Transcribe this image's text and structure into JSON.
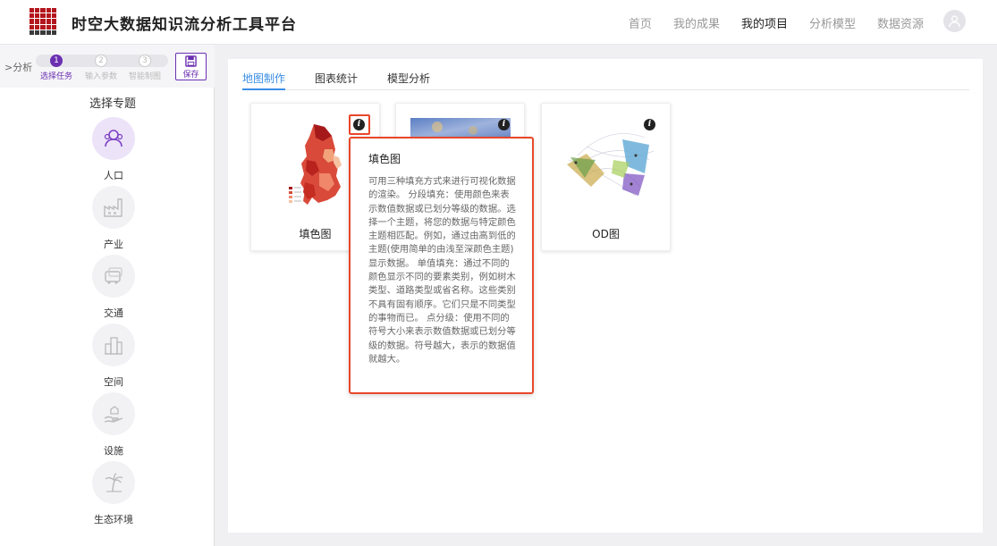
{
  "app": {
    "title": "时空大数据知识流分析工具平台"
  },
  "nav": {
    "items": [
      "首页",
      "我的成果",
      "我的项目",
      "分析模型",
      "数据资源"
    ],
    "active_index": 2
  },
  "sidebar": {
    "breadcrumb": ">分析",
    "steps": [
      {
        "num": "1",
        "label": "选择任务"
      },
      {
        "num": "2",
        "label": "输入参数"
      },
      {
        "num": "3",
        "label": "智能制图"
      }
    ],
    "save_label": "保存",
    "section_title": "选择专题",
    "topics": [
      {
        "label": "人口",
        "icon": "people-icon"
      },
      {
        "label": "产业",
        "icon": "factory-icon"
      },
      {
        "label": "交通",
        "icon": "transport-icon"
      },
      {
        "label": "空间",
        "icon": "buildings-icon"
      },
      {
        "label": "设施",
        "icon": "facility-hand-icon"
      },
      {
        "label": "生态环境",
        "icon": "palm-tree-icon"
      }
    ]
  },
  "main": {
    "tabs": [
      "地图制作",
      "图表统计",
      "模型分析"
    ],
    "active_tab": 0,
    "cards": [
      {
        "label": "填色图",
        "thumb": "choropleth-map-thumbnail"
      },
      {
        "label": "",
        "thumb": "heatmap-thumbnail"
      },
      {
        "label": "OD图",
        "thumb": "od-flow-map-thumbnail"
      }
    ]
  },
  "tooltip": {
    "title": "填色图",
    "body": "可用三种填充方式来进行可视化数据的渲染。 分段填充：使用颜色来表示数值数据或已划分等级的数据。选择一个主题，将您的数据与特定颜色主题相匹配。例如，通过由高到低的主题(使用简单的由浅至深颜色主题)显示数据。 单值填充：通过不同的颜色显示不同的要素类别，例如树木类型、道路类型或省名称。这些类别不具有固有顺序。它们只是不同类型的事物而已。 点分级：使用不同的符号大小来表示数值数据或已划分等级的数据。符号越大，表示的数据值就越大。"
  },
  "colors": {
    "brand_red": "#b3161c",
    "accent_purple": "#6b2fb1",
    "tab_blue": "#3a8ee6",
    "highlight_orange": "#e8472a"
  }
}
